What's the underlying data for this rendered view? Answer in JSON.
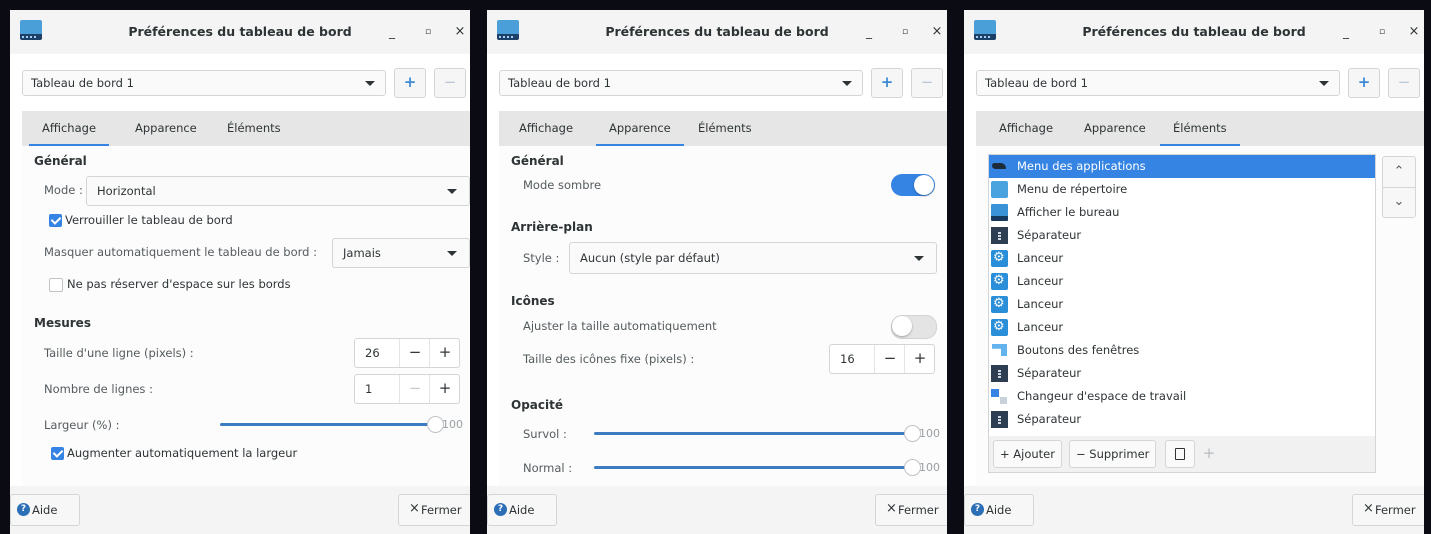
{
  "windows": [
    {
      "title": "Préférences du tableau de bord",
      "window_controls": {
        "minimize": "_",
        "maximize": "▫",
        "close": "×"
      },
      "panel_selector": {
        "value": "Tableau de bord 1",
        "add": "+",
        "remove": "−"
      },
      "tabs": [
        "Affichage",
        "Apparence",
        "Éléments"
      ],
      "active_tab": "Affichage",
      "general": {
        "heading": "Général",
        "mode_label": "Mode :",
        "mode_value": "Horizontal",
        "lock_label": "Verrouiller le tableau de bord",
        "lock_checked": true,
        "autohide_label": "Masquer automatiquement le tableau de bord :",
        "autohide_value": "Jamais",
        "no_reserve_label": "Ne pas réserver d'espace sur les bords",
        "no_reserve_checked": false
      },
      "measures": {
        "heading": "Mesures",
        "row_size_label": "Taille d'une ligne (pixels) :",
        "row_size_value": "26",
        "rows_label": "Nombre de lignes :",
        "rows_value": "1",
        "width_label": "Largeur (%) :",
        "width_value": "100",
        "auto_width_label": "Augmenter automatiquement la largeur",
        "auto_width_checked": true
      },
      "footer": {
        "help": "Aide",
        "close": "Fermer"
      }
    },
    {
      "title": "Préférences du tableau de bord",
      "window_controls": {
        "minimize": "_",
        "maximize": "▫",
        "close": "×"
      },
      "panel_selector": {
        "value": "Tableau de bord 1",
        "add": "+",
        "remove": "−"
      },
      "tabs": [
        "Affichage",
        "Apparence",
        "Éléments"
      ],
      "active_tab": "Apparence",
      "general": {
        "heading": "Général",
        "dark_mode_label": "Mode sombre",
        "dark_mode_on": true
      },
      "background": {
        "heading": "Arrière-plan",
        "style_label": "Style :",
        "style_value": "Aucun (style par défaut)"
      },
      "icons": {
        "heading": "Icônes",
        "auto_size_label": "Ajuster la taille automatiquement",
        "auto_size_on": false,
        "fixed_size_label": "Taille des icônes fixe (pixels) :",
        "fixed_size_value": "16"
      },
      "opacity": {
        "heading": "Opacité",
        "hover_label": "Survol :",
        "hover_value": "100",
        "normal_label": "Normal :",
        "normal_value": "100"
      },
      "footer": {
        "help": "Aide",
        "close": "Fermer"
      }
    },
    {
      "title": "Préférences du tableau de bord",
      "window_controls": {
        "minimize": "_",
        "maximize": "▫",
        "close": "×"
      },
      "panel_selector": {
        "value": "Tableau de bord 1",
        "add": "+",
        "remove": "−"
      },
      "tabs": [
        "Affichage",
        "Apparence",
        "Éléments"
      ],
      "active_tab": "Éléments",
      "items": [
        {
          "label": "Menu des applications",
          "icon": "app-menu-icon",
          "selected": true
        },
        {
          "label": "Menu de répertoire",
          "icon": "folder-icon"
        },
        {
          "label": "Afficher le bureau",
          "icon": "desktop-icon"
        },
        {
          "label": "Séparateur",
          "icon": "separator-icon"
        },
        {
          "label": "Lanceur",
          "icon": "launcher-icon"
        },
        {
          "label": "Lanceur",
          "icon": "launcher-icon"
        },
        {
          "label": "Lanceur",
          "icon": "launcher-icon"
        },
        {
          "label": "Lanceur",
          "icon": "launcher-icon"
        },
        {
          "label": "Boutons des fenêtres",
          "icon": "window-buttons-icon"
        },
        {
          "label": "Séparateur",
          "icon": "separator-icon"
        },
        {
          "label": "Changeur d'espace de travail",
          "icon": "workspace-switcher-icon"
        },
        {
          "label": "Séparateur",
          "icon": "separator-icon"
        }
      ],
      "list_actions": {
        "add": "+ Ajouter",
        "remove": "− Supprimer",
        "move_up": "⌃",
        "move_down": "⌄"
      },
      "footer": {
        "help": "Aide",
        "close": "Fermer"
      }
    }
  ],
  "colors": {
    "accent": "#3584e4",
    "slider": "#3b7bc2"
  }
}
